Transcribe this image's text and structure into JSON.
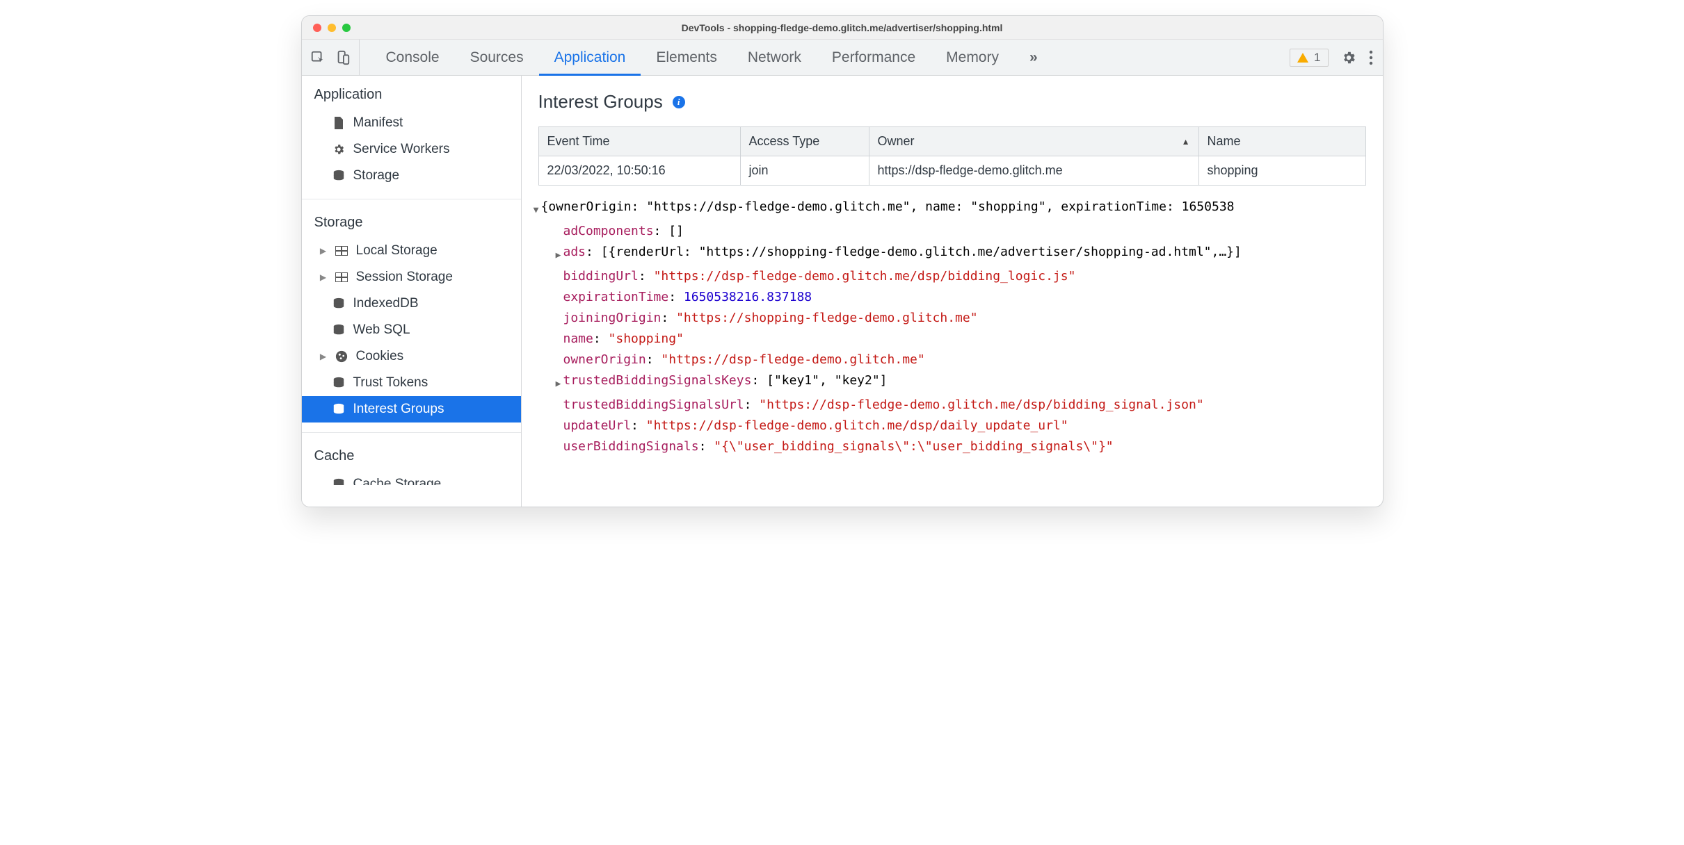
{
  "window": {
    "title": "DevTools - shopping-fledge-demo.glitch.me/advertiser/shopping.html"
  },
  "toolbar": {
    "tabs": [
      "Console",
      "Sources",
      "Application",
      "Elements",
      "Network",
      "Performance",
      "Memory"
    ],
    "active_tab": "Application",
    "warnings": "1"
  },
  "sidebar": {
    "sections": [
      {
        "title": "Application",
        "items": [
          {
            "label": "Manifest",
            "icon": "file-icon"
          },
          {
            "label": "Service Workers",
            "icon": "gear-icon"
          },
          {
            "label": "Storage",
            "icon": "db-icon"
          }
        ]
      },
      {
        "title": "Storage",
        "items": [
          {
            "label": "Local Storage",
            "icon": "grid-icon",
            "expandable": true
          },
          {
            "label": "Session Storage",
            "icon": "grid-icon",
            "expandable": true
          },
          {
            "label": "IndexedDB",
            "icon": "db-icon"
          },
          {
            "label": "Web SQL",
            "icon": "db-icon"
          },
          {
            "label": "Cookies",
            "icon": "cookie-icon",
            "expandable": true
          },
          {
            "label": "Trust Tokens",
            "icon": "db-icon"
          },
          {
            "label": "Interest Groups",
            "icon": "db-icon",
            "selected": true
          }
        ]
      },
      {
        "title": "Cache",
        "items": [
          {
            "label": "Cache Storage",
            "icon": "db-icon"
          }
        ]
      }
    ]
  },
  "panel": {
    "title": "Interest Groups",
    "columns": [
      "Event Time",
      "Access Type",
      "Owner",
      "Name"
    ],
    "rows": [
      {
        "event_time": "22/03/2022, 10:50:16",
        "access_type": "join",
        "owner": "https://dsp-fledge-demo.glitch.me",
        "name": "shopping"
      }
    ]
  },
  "details": {
    "top": "{ownerOrigin: \"https://dsp-fledge-demo.glitch.me\", name: \"shopping\", expirationTime: 1650538",
    "adComponents_key": "adComponents",
    "adComponents_val": "[]",
    "ads_key": "ads",
    "ads_val": "[{renderUrl: \"https://shopping-fledge-demo.glitch.me/advertiser/shopping-ad.html\",…}]",
    "biddingUrl_key": "biddingUrl",
    "biddingUrl_val": "\"https://dsp-fledge-demo.glitch.me/dsp/bidding_logic.js\"",
    "expirationTime_key": "expirationTime",
    "expirationTime_val": "1650538216.837188",
    "joiningOrigin_key": "joiningOrigin",
    "joiningOrigin_val": "\"https://shopping-fledge-demo.glitch.me\"",
    "name_key": "name",
    "name_val": "\"shopping\"",
    "ownerOrigin_key": "ownerOrigin",
    "ownerOrigin_val": "\"https://dsp-fledge-demo.glitch.me\"",
    "tbsk_key": "trustedBiddingSignalsKeys",
    "tbsk_val": "[\"key1\", \"key2\"]",
    "tbsu_key": "trustedBiddingSignalsUrl",
    "tbsu_val": "\"https://dsp-fledge-demo.glitch.me/dsp/bidding_signal.json\"",
    "updateUrl_key": "updateUrl",
    "updateUrl_val": "\"https://dsp-fledge-demo.glitch.me/dsp/daily_update_url\"",
    "ubs_key": "userBiddingSignals",
    "ubs_val": "\"{\\\"user_bidding_signals\\\":\\\"user_bidding_signals\\\"}\""
  }
}
